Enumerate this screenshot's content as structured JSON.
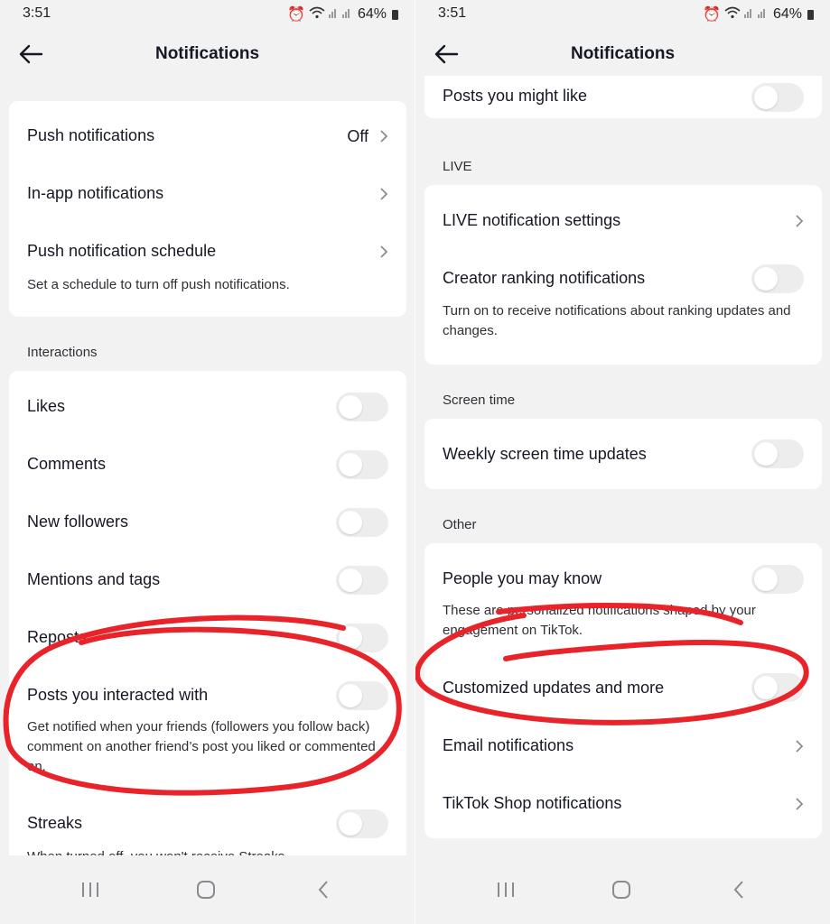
{
  "status_bar": {
    "time": "3:51",
    "battery": "64%"
  },
  "header": {
    "title": "Notifications"
  },
  "left": {
    "general": [
      {
        "label": "Push notifications",
        "value": "Off"
      },
      {
        "label": "In-app notifications"
      },
      {
        "label": "Push notification schedule",
        "sub": "Set a schedule to turn off push notifications."
      }
    ],
    "interactions": {
      "title": "Interactions",
      "items": [
        {
          "label": "Likes"
        },
        {
          "label": "Comments"
        },
        {
          "label": "New followers"
        },
        {
          "label": "Mentions and tags"
        },
        {
          "label": "Reposts"
        },
        {
          "label": "Posts you interacted with",
          "sub": "Get notified when your friends (followers you follow back) comment on another friend’s post you liked or commented on."
        },
        {
          "label": "Streaks",
          "sub": "When turned off, you won't receive Streaks"
        }
      ]
    }
  },
  "right": {
    "top": {
      "label": "Posts you might like"
    },
    "live": {
      "title": "LIVE",
      "items": [
        {
          "label": "LIVE notification settings"
        },
        {
          "label": "Creator ranking notifications",
          "sub": "Turn on to receive notifications about ranking updates and changes."
        }
      ]
    },
    "screen_time": {
      "title": "Screen time",
      "items": [
        {
          "label": "Weekly screen time updates"
        }
      ]
    },
    "other": {
      "title": "Other",
      "items": [
        {
          "label": "People you may know",
          "sub": "These are personalized notifications shaped by your engagement on TikTok."
        },
        {
          "label": "Customized updates and more"
        },
        {
          "label": "Email notifications"
        },
        {
          "label": "TikTok Shop notifications"
        }
      ]
    }
  },
  "colors": {
    "background": "#f2f2f3",
    "card": "#ffffff",
    "toggle_off": "#ededee",
    "annotation": "#e8232a"
  }
}
